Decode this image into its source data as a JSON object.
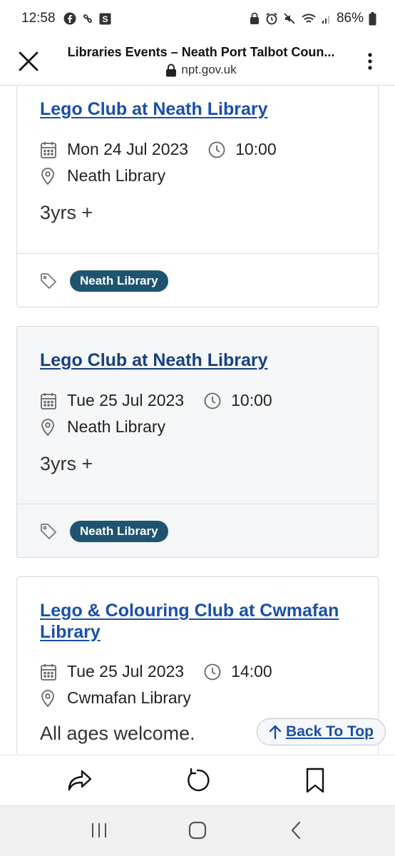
{
  "status_bar": {
    "time": "12:58",
    "battery": "86%"
  },
  "browser": {
    "title": "Libraries Events – Neath Port Talbot Coun...",
    "url": "npt.gov.uk"
  },
  "events": [
    {
      "title": "Lego Club at Neath Library",
      "date": "Mon 24 Jul 2023",
      "time": "10:00",
      "location": "Neath Library",
      "description": "3yrs +",
      "tag": "Neath Library"
    },
    {
      "title": "Lego Club at Neath Library",
      "date": "Tue 25 Jul 2023",
      "time": "10:00",
      "location": "Neath Library",
      "description": "3yrs +",
      "tag": "Neath Library"
    },
    {
      "title_line1": "Lego & Colouring Club at Cwmafan",
      "title_line2": "Library",
      "date": "Tue 25 Jul 2023",
      "time": "14:00",
      "location": "Cwmafan Library",
      "description": "All ages welcome."
    }
  ],
  "back_to_top": "Back To Top",
  "colors": {
    "link": "#1a4fa8",
    "tag_bg": "#1f5470",
    "alt_card_bg": "#f4f6f8"
  }
}
